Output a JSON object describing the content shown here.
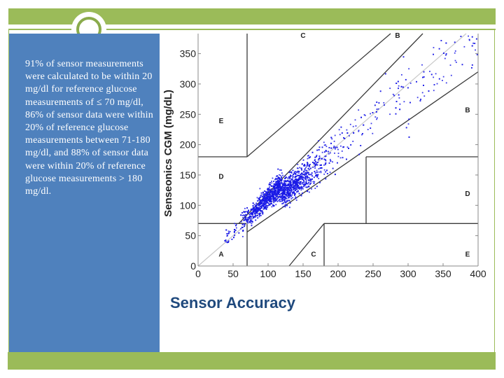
{
  "slide": {
    "description": "91% of sensor measurements were calculated to be within 20 mg/dl for reference glucose measurements of ≤ 70 mg/dl, 86% of sensor data were within 20% of reference glucose measurements between 71-180 mg/dl, and 88% of sensor data were within 20% of reference glucose measurements > 180 mg/dl.",
    "caption": "Sensor Accuracy",
    "colors": {
      "accent_green": "#9bbb59",
      "panel_blue": "#4f81bd",
      "caption_navy": "#1f497d",
      "point_blue": "#1a1ae6"
    }
  },
  "chart_data": {
    "type": "scatter",
    "title": "",
    "xlabel": "",
    "ylabel": "Senseonics CGM (mg/dL)",
    "xlim": [
      0,
      400
    ],
    "ylim": [
      0,
      383
    ],
    "x_ticks": [
      0,
      50,
      100,
      150,
      200,
      250,
      300,
      350,
      400
    ],
    "y_ticks": [
      0,
      50,
      100,
      150,
      200,
      250,
      300,
      350
    ],
    "grid": false,
    "legend": "none",
    "identity_line": [
      [
        0,
        0
      ],
      [
        383,
        383
      ]
    ],
    "zone_lines": [
      {
        "name": "upper-c-boundary",
        "points": [
          [
            70,
            180
          ],
          [
            275,
            383
          ]
        ]
      },
      {
        "name": "upper-b-boundary",
        "points": [
          [
            58,
            70
          ],
          [
            321,
            383
          ]
        ]
      },
      {
        "name": "lower-b-boundary",
        "points": [
          [
            70,
            56
          ],
          [
            400,
            320
          ]
        ]
      },
      {
        "name": "lower-c-boundary",
        "points": [
          [
            130,
            0
          ],
          [
            180,
            70
          ]
        ]
      },
      {
        "name": "left-e-vertical",
        "points": [
          [
            70,
            180
          ],
          [
            70,
            383
          ]
        ]
      },
      {
        "name": "left-d-top",
        "points": [
          [
            0,
            180
          ],
          [
            70,
            180
          ]
        ]
      },
      {
        "name": "left-d-bottom",
        "points": [
          [
            0,
            70
          ],
          [
            70,
            70
          ]
        ]
      },
      {
        "name": "left-a-vertical",
        "points": [
          [
            70,
            0
          ],
          [
            70,
            70
          ]
        ]
      },
      {
        "name": "right-e-vertical",
        "points": [
          [
            180,
            0
          ],
          [
            180,
            70
          ]
        ]
      },
      {
        "name": "right-e-top",
        "points": [
          [
            180,
            70
          ],
          [
            400,
            70
          ]
        ]
      },
      {
        "name": "right-d-vertical",
        "points": [
          [
            240,
            70
          ],
          [
            240,
            180
          ]
        ]
      },
      {
        "name": "right-d-top",
        "points": [
          [
            240,
            180
          ],
          [
            400,
            180
          ]
        ]
      }
    ],
    "zone_labels": [
      {
        "label": "C",
        "x": 150,
        "y": 383
      },
      {
        "label": "B",
        "x": 285,
        "y": 383
      },
      {
        "label": "E",
        "x": 33,
        "y": 240
      },
      {
        "label": "B",
        "x": 385,
        "y": 258
      },
      {
        "label": "D",
        "x": 33,
        "y": 148
      },
      {
        "label": "D",
        "x": 385,
        "y": 120
      },
      {
        "label": "A",
        "x": 33,
        "y": 20
      },
      {
        "label": "C",
        "x": 165,
        "y": 20
      },
      {
        "label": "E",
        "x": 385,
        "y": 20
      }
    ],
    "scatter_summary": {
      "approx_points": 2600,
      "x_range": [
        33,
        400
      ],
      "trend": "points cluster along the identity line, densest between 60 and 230 mg/dL reference, mostly within zones A and B"
    }
  }
}
